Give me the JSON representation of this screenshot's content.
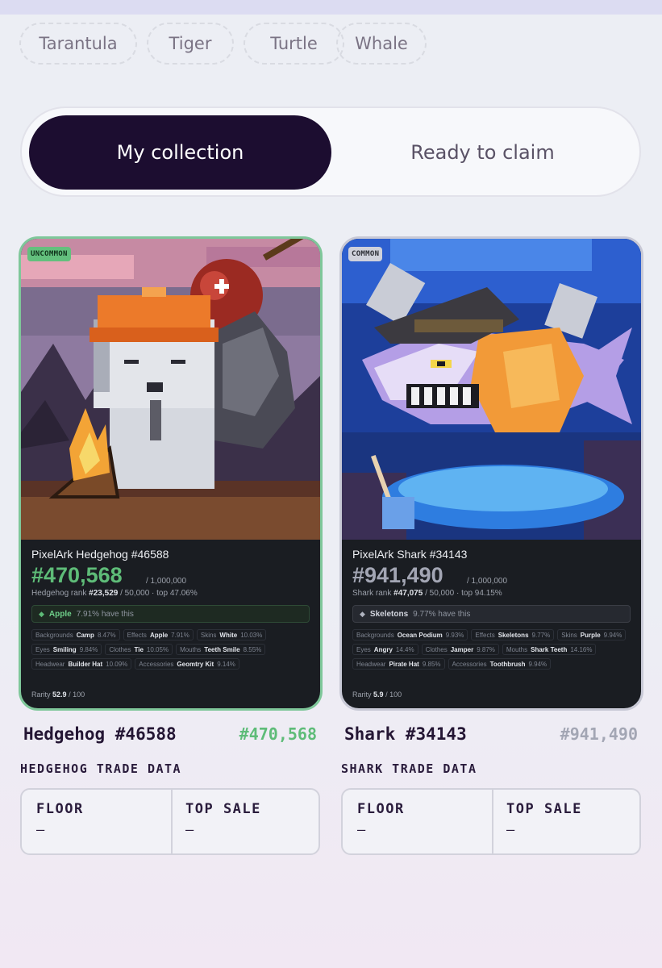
{
  "filters": [
    "Tarantula",
    "Tiger",
    "Turtle",
    "Whale"
  ],
  "tabs": {
    "active": "My collection",
    "inactive": "Ready to claim"
  },
  "cards": [
    {
      "rarity_tag": "UNCOMMON",
      "title": "PixelArk Hedgehog #46588",
      "rank": "#470,568",
      "rank_total": "/ 1,000,000",
      "species_rank_label": "Hedgehog rank",
      "species_rank": "#23,529",
      "species_rank_rest": "/ 50,000 · top 47.06%",
      "highlight": {
        "icon": "◆",
        "name": "Apple",
        "pct": "7.91% have this"
      },
      "traits": [
        {
          "k": "Backgrounds",
          "v": "Camp",
          "p": "8.47%"
        },
        {
          "k": "Effects",
          "v": "Apple",
          "p": "7.91%"
        },
        {
          "k": "Skins",
          "v": "White",
          "p": "10.03%"
        },
        {
          "k": "Eyes",
          "v": "Smiling",
          "p": "9.84%"
        },
        {
          "k": "Clothes",
          "v": "Tie",
          "p": "10.05%"
        },
        {
          "k": "Mouths",
          "v": "Teeth Smile",
          "p": "8.55%"
        },
        {
          "k": "Headwear",
          "v": "Builder Hat",
          "p": "10.09%"
        },
        {
          "k": "Accessories",
          "v": "Geomtry Kit",
          "p": "9.14%"
        }
      ],
      "rarity_label": "Rarity",
      "rarity_score": "52.9",
      "rarity_max": "/ 100",
      "name": "Hedgehog #46588",
      "rank_short": "#470,568",
      "trade_heading": "HEDGEHOG TRADE DATA",
      "floor_label": "FLOOR",
      "floor_value": "—",
      "top_sale_label": "TOP SALE",
      "top_sale_value": "—"
    },
    {
      "rarity_tag": "COMMON",
      "title": "PixelArk Shark #34143",
      "rank": "#941,490",
      "rank_total": "/ 1,000,000",
      "species_rank_label": "Shark rank",
      "species_rank": "#47,075",
      "species_rank_rest": "/ 50,000 · top 94.15%",
      "highlight": {
        "icon": "◆",
        "name": "Skeletons",
        "pct": "9.77% have this"
      },
      "traits": [
        {
          "k": "Backgrounds",
          "v": "Ocean Podium",
          "p": "9.93%"
        },
        {
          "k": "Effects",
          "v": "Skeletons",
          "p": "9.77%"
        },
        {
          "k": "Skins",
          "v": "Purple",
          "p": "9.94%"
        },
        {
          "k": "Eyes",
          "v": "Angry",
          "p": "14.4%"
        },
        {
          "k": "Clothes",
          "v": "Jamper",
          "p": "9.87%"
        },
        {
          "k": "Mouths",
          "v": "Shark Teeth",
          "p": "14.16%"
        },
        {
          "k": "Headwear",
          "v": "Pirate Hat",
          "p": "9.85%"
        },
        {
          "k": "Accessories",
          "v": "Toothbrush",
          "p": "9.94%"
        }
      ],
      "rarity_label": "Rarity",
      "rarity_score": "5.9",
      "rarity_max": "/ 100",
      "name": "Shark #34143",
      "rank_short": "#941,490",
      "trade_heading": "SHARK TRADE DATA",
      "floor_label": "FLOOR",
      "floor_value": "—",
      "top_sale_label": "TOP SALE",
      "top_sale_value": "—"
    }
  ],
  "colors": {
    "uncommon_accent": "#5ebc78",
    "common_accent": "#a3a6b4",
    "active_tab_bg": "#1c0d30"
  }
}
